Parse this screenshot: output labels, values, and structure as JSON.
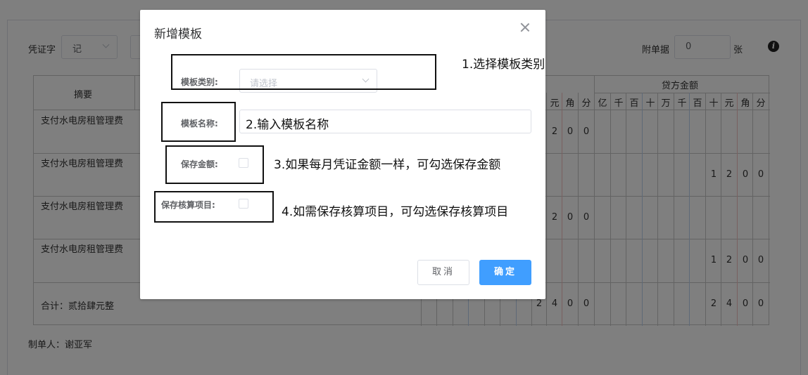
{
  "voucher": {
    "word_label": "凭证字",
    "word_value": "记",
    "attach_label": "附单据",
    "attach_value": "0",
    "attach_unit": "张",
    "info_glyph": "i"
  },
  "table": {
    "header_summary": "摘要",
    "header_credit": "贷方金额",
    "debit_units_visible": [
      "元",
      "角",
      "分"
    ],
    "credit_units": [
      "亿",
      "千",
      "百",
      "十",
      "万",
      "千",
      "百",
      "十",
      "元",
      "角",
      "分"
    ],
    "rows": [
      {
        "summary": "支付水电房租管理费",
        "debit": [
          "2",
          "0",
          "0"
        ],
        "credit": [
          "",
          "",
          "",
          "",
          "",
          "",
          "",
          "",
          "",
          "",
          ""
        ]
      },
      {
        "summary": "支付水电房租管理费",
        "debit": [
          "",
          "",
          ""
        ],
        "credit": [
          "",
          "",
          "",
          "",
          "",
          "",
          "",
          "1",
          "2",
          "0",
          "0"
        ]
      },
      {
        "summary": "支付水电房租管理费",
        "debit": [
          "2",
          "0",
          "0"
        ],
        "credit": [
          "",
          "",
          "",
          "",
          "",
          "",
          "",
          "",
          "",
          "",
          ""
        ]
      },
      {
        "summary": "支付水电房租管理费",
        "debit": [
          "",
          "",
          ""
        ],
        "credit": [
          "",
          "",
          "",
          "",
          "",
          "",
          "",
          "1",
          "2",
          "0",
          "0"
        ]
      }
    ],
    "total_label": "合计：贰拾肆元整",
    "total_debit": [
      "2",
      "4",
      "0",
      "0"
    ],
    "total_credit": [
      "2",
      "4",
      "0",
      "0"
    ]
  },
  "maker": "制单人：谢亚军",
  "dialog": {
    "title": "新增模板",
    "category_label": "模板类别:",
    "category_placeholder": "请选择",
    "name_label": "模板名称:",
    "name_value": "2.输入模板名称",
    "save_amount_label": "保存金额:",
    "save_item_label": "保存核算项目:",
    "cancel": "取消",
    "confirm": "确定"
  },
  "annotations": {
    "step1": "1.选择模板类别",
    "step3": "3.如果每月凭证金额一样，可勾选保存金额",
    "step4": "4.如需保存核算项目，可勾选保存核算项目"
  }
}
